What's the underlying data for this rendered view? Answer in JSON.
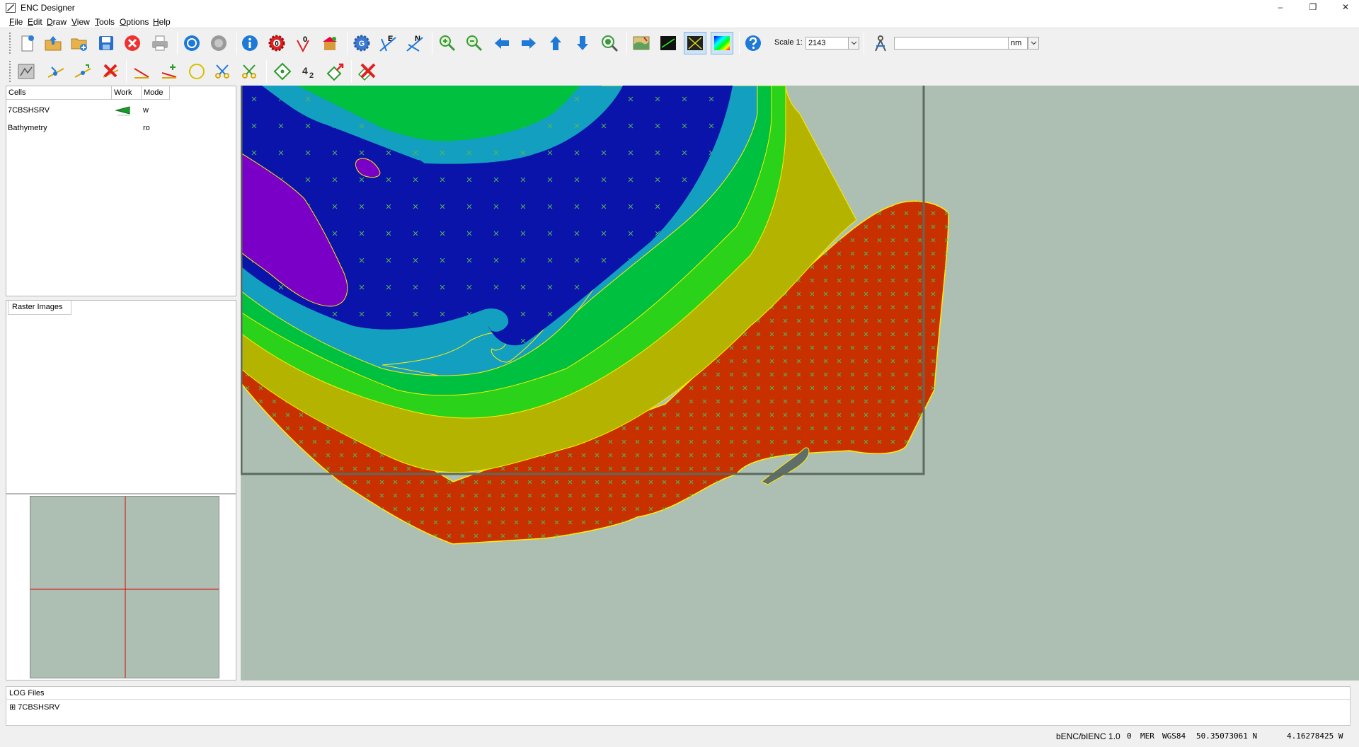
{
  "window": {
    "title": "ENC Designer",
    "minimize": "–",
    "restore": "❐",
    "close": "✕"
  },
  "menu": {
    "items": [
      {
        "first": "F",
        "rest": "ile"
      },
      {
        "first": "E",
        "rest": "dit"
      },
      {
        "first": "D",
        "rest": "raw"
      },
      {
        "first": "V",
        "rest": "iew"
      },
      {
        "first": "T",
        "rest": "ools"
      },
      {
        "first": "O",
        "rest": "ptions"
      },
      {
        "first": "H",
        "rest": "elp"
      }
    ]
  },
  "toolbar": {
    "scale_label": "Scale 1:",
    "scale_value": "2143",
    "measure_value": "",
    "unit_value": "nm",
    "icon_text": {
      "zero": "0",
      "g": "G",
      "e": "E",
      "n": "N",
      "four": "4",
      "two": "2"
    }
  },
  "cells_panel": {
    "headers": [
      "Cells",
      "Work",
      "Mode"
    ],
    "rows": [
      {
        "name": "7CBSHSRV",
        "mode": "w"
      },
      {
        "name": "Bathymetry",
        "mode": "ro"
      }
    ]
  },
  "raster_panel": {
    "tab_label": "Raster Images"
  },
  "log_panel": {
    "header": "LOG Files",
    "items": [
      {
        "expander": "⊞",
        "label": "7CBSHSRV"
      }
    ]
  },
  "status_bar": {
    "product": "bENC/bIENC 1.0",
    "field1": "0",
    "projection": "MER",
    "datum": "WGS84",
    "latitude": "50.35073061 N",
    "longitude": "4.16278425 W"
  },
  "colors": {
    "land": "#adbfb2",
    "depth_deep_purple": "#7a00c8",
    "depth_blue": "#0a14aa",
    "depth_cyan": "#13a0c0",
    "depth_green": "#00c040",
    "depth_lime": "#2ad21a",
    "depth_olive": "#b4b400",
    "drying_area": "#c83000",
    "rock": "#5f6e6a",
    "contour": "#ffee00",
    "overview_cross": "#e00000"
  }
}
